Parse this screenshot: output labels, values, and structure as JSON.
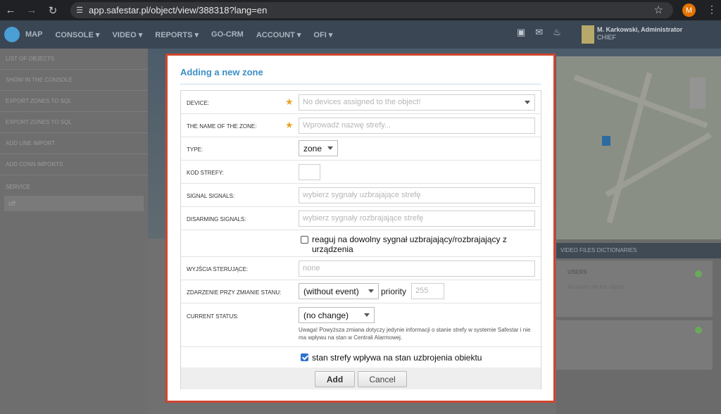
{
  "browser": {
    "url": "app.safestar.pl/object/view/388318?lang=en",
    "profile_initial": "M"
  },
  "app": {
    "nav": [
      "MAP",
      "CONSOLE ▾",
      "VIDEO ▾",
      "REPORTS ▾",
      "GO-CRM",
      "ACCOUNT ▾",
      "OFI ▾"
    ],
    "user_name": "M. Karkowski, Administrator",
    "user_role": "CHIEF"
  },
  "sidebar": {
    "items": [
      "LIST OF OBJECTS",
      "SHOW IN THE CONSOLE",
      "EXPORT ZONES TO SQL",
      "EXPORT ZONES TO SQL",
      "ADD LINE IMPORT",
      "ADD CONN IMPORTS"
    ],
    "section": "SERVICE",
    "select_value": "off"
  },
  "background": {
    "tabs": "VIDEO   FILES   DICTIONARIES",
    "panel_header": "USERS",
    "panel_text": "No users on the object."
  },
  "modal": {
    "title": "Adding a new zone",
    "device_label": "DEVICE:",
    "device_placeholder": "No devices assigned to the object!",
    "name_label": "THE NAME OF THE ZONE:",
    "name_placeholder": "Wprowadź nazwę strefy...",
    "type_label": "TYPE:",
    "type_value": "zone",
    "kod_label": "KOD STREFY:",
    "kod_value": "",
    "signal_label": "SIGNAL SIGNALS:",
    "signal_placeholder": "wybierz sygnały uzbrajające strefę",
    "disarm_label": "DISARMING SIGNALS:",
    "disarm_placeholder": "wybierz sygnały rozbrajające strefę",
    "any_signal_text": "reaguj na dowolny sygnał uzbrajający/rozbrajający z urządzenia",
    "any_signal_checked": false,
    "outputs_label": "WYJŚCIA STERUJĄCE:",
    "outputs_placeholder": "none",
    "event_label": "ZDARZENIE PRZY ZMIANIE STANU:",
    "event_value": "(without event)",
    "priority_label": "priority",
    "priority_placeholder": "255",
    "status_label": "CURRENT STATUS:",
    "status_value": "(no change)",
    "status_note": "Uwaga! Powyższa zmiana dotyczy jedynie informacji o stanie strefy w systemie Safestar i nie ma wpływu na stan w Centrali Alarmowej.",
    "affects_text": "stan strefy wpływa na stan uzbrojenia obiektu",
    "affects_checked": true,
    "add_label": "Add",
    "cancel_label": "Cancel"
  },
  "colors": {
    "accent": "#3d8fc6",
    "modal_border": "#d0452f",
    "required": "#e9a42a",
    "checkbox": "#2f6fd0"
  }
}
